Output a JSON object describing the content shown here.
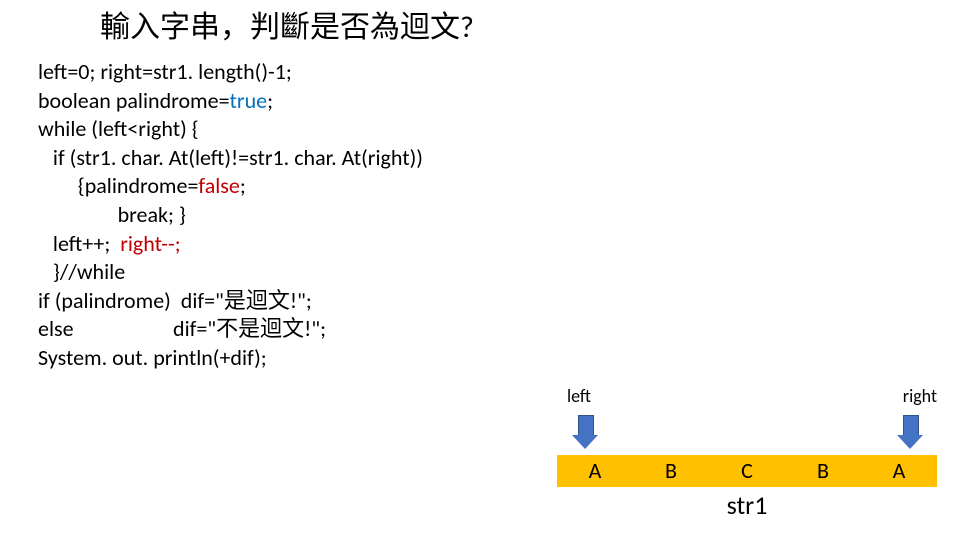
{
  "title": "輸入字串，判斷是否為迴文?",
  "code": {
    "l1": "left=0; right=str1. length()-1;",
    "l2a": "boolean palindrome=",
    "l2b": "true",
    "l2c": ";",
    "l3": "while (left<right) {",
    "l4": "   if (str1. char. At(left)!=str1. char. At(right))",
    "l5a": "        {palindrome=",
    "l5b": "false",
    "l5c": ";",
    "l6": "                break; }",
    "l7a": "   left++;  ",
    "l7b": "right--;",
    "l8": "   }//while",
    "l9": "if (palindrome)  dif=\"是迴文!\";",
    "l10": "else                    dif=\"不是迴文!\";",
    "l11": "System. out. println(+dif);"
  },
  "diagram": {
    "leftLabel": "left",
    "rightLabel": "right",
    "cells": [
      "A",
      "B",
      "C",
      "B",
      "A"
    ],
    "varName": "str1"
  }
}
